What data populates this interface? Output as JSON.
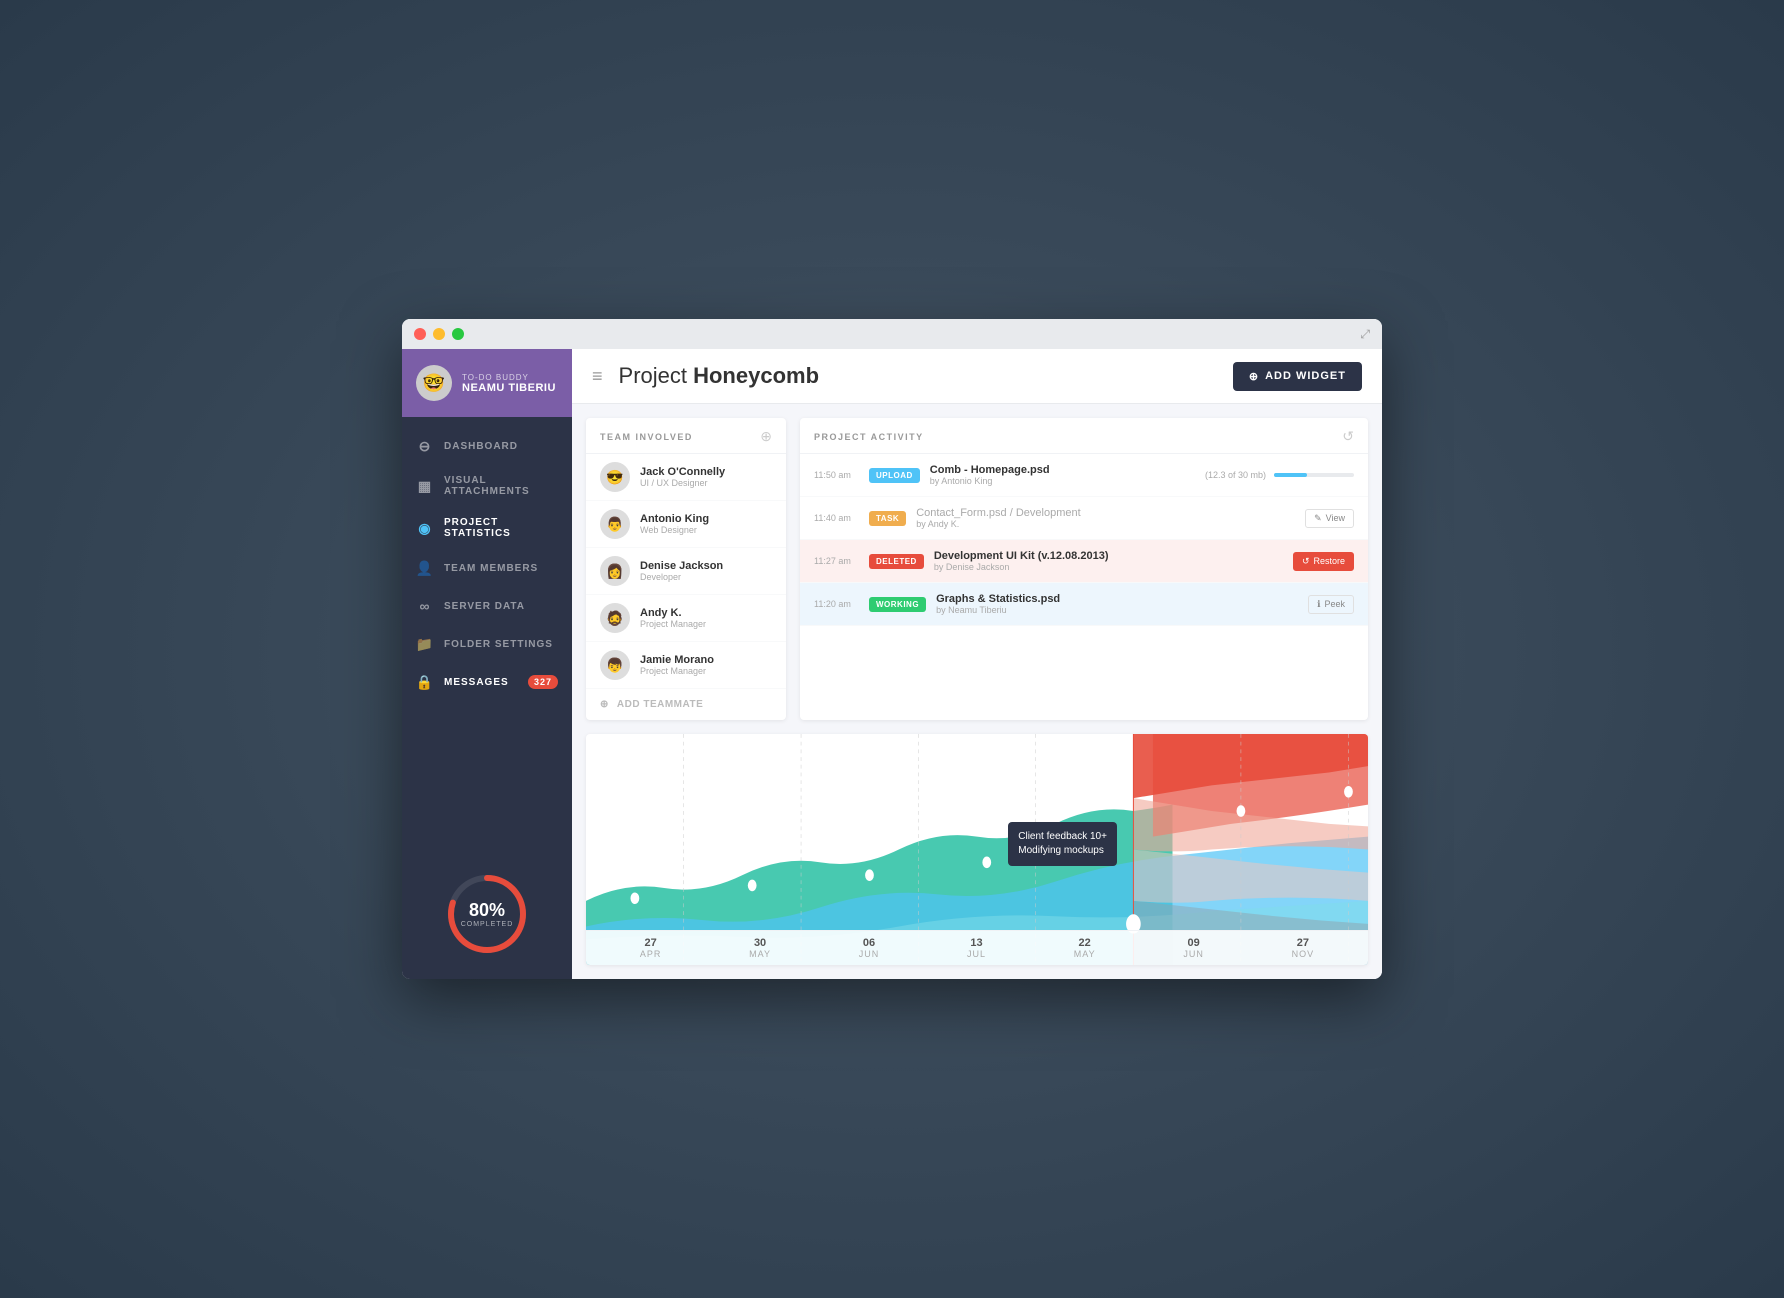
{
  "app": {
    "title": "TO-DO BUDDY",
    "user_name": "NEAMU TIBERIU"
  },
  "nav": {
    "items": [
      {
        "id": "dashboard",
        "label": "DASHBOARD",
        "icon": "⊖"
      },
      {
        "id": "visual-attachments",
        "label": "VISUAL ATTACHMENTS",
        "icon": "🖼"
      },
      {
        "id": "project-statistics",
        "label": "PROJECT STATISTICS",
        "icon": "👁",
        "active": true
      },
      {
        "id": "team-members",
        "label": "TEAM MEMBERS",
        "icon": "👤"
      },
      {
        "id": "server-data",
        "label": "SERVER DATA",
        "icon": "∞"
      },
      {
        "id": "folder-settings",
        "label": "FOLDER SETTINGS",
        "icon": "📁"
      }
    ],
    "messages": {
      "label": "MESSAGES",
      "count": "327"
    }
  },
  "progress": {
    "percent": 80,
    "label": "COMPLETED",
    "display": "80%"
  },
  "header": {
    "title_prefix": "Project ",
    "title_bold": "Honeycomb",
    "add_widget": "ADD WIDGET",
    "menu_icon": "≡"
  },
  "team_panel": {
    "title": "TEAM INVOLVED",
    "members": [
      {
        "name": "Jack O'Connelly",
        "role": "UI / UX Designer",
        "emoji": "😎"
      },
      {
        "name": "Antonio King",
        "role": "Web Designer",
        "emoji": "👨"
      },
      {
        "name": "Denise Jackson",
        "role": "Developer",
        "emoji": "👩"
      },
      {
        "name": "Andy K.",
        "role": "Project Manager",
        "emoji": "🧔"
      },
      {
        "name": "Jamie Morano",
        "role": "Project Manager",
        "emoji": "👦"
      }
    ],
    "add_button": "ADD TEAMMATE"
  },
  "activity_panel": {
    "title": "PROJECT ACTIVITY",
    "items": [
      {
        "badge": "UPLOAD",
        "badge_type": "upload",
        "time": "11:50 am",
        "filename": "Comb - Homepage.psd",
        "by": "by Antonio King",
        "size": "(12.3 of 30 mb)",
        "progress": 41,
        "action": null
      },
      {
        "badge": "TASK",
        "badge_type": "task",
        "time": "11:40 am",
        "filename": "Contact_Form.psd",
        "filename_suffix": " / Development",
        "by": "by Andy K.",
        "action": "View"
      },
      {
        "badge": "DELETED",
        "badge_type": "deleted",
        "time": "11:27 am",
        "filename": "Development UI Kit (v.12.08.2013)",
        "by": "by Denise Jackson",
        "action": "Restore"
      },
      {
        "badge": "WORKING",
        "badge_type": "working",
        "time": "11:20 am",
        "filename": "Graphs & Statistics.psd",
        "by": "by Neamu Tiberiu",
        "action": "Peek"
      }
    ]
  },
  "chart": {
    "tooltip": {
      "line1": "Client feedback 10+",
      "line2": "Modifying mockups"
    },
    "timeline": [
      {
        "date": "27",
        "month": "APR"
      },
      {
        "date": "30",
        "month": "MAY"
      },
      {
        "date": "06",
        "month": "JUN"
      },
      {
        "date": "13",
        "month": "JUL"
      },
      {
        "date": "22",
        "month": "MAY"
      },
      {
        "date": "09",
        "month": "JUN"
      },
      {
        "date": "27",
        "month": "NOV"
      }
    ]
  }
}
